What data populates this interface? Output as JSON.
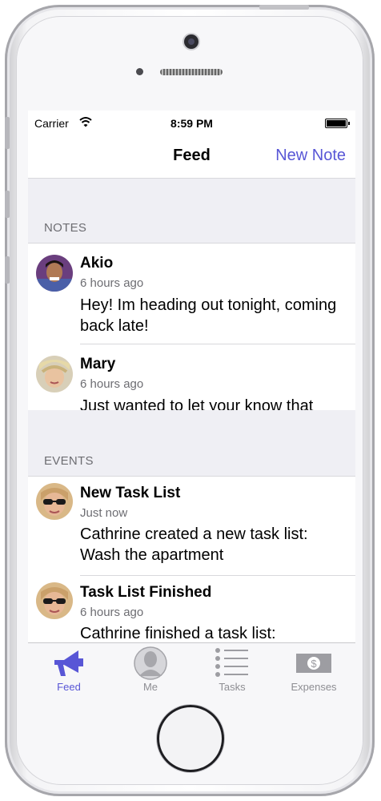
{
  "status_bar": {
    "carrier": "Carrier",
    "time": "8:59 PM"
  },
  "nav": {
    "title": "Feed",
    "action": "New Note"
  },
  "notes_section": {
    "title": "NOTES",
    "items": [
      {
        "name": "Akio",
        "time": "6 hours ago",
        "body": "Hey! Im heading out tonight, coming back late!",
        "avatar": "avatar-akio"
      },
      {
        "name": "Mary",
        "time": "6 hours ago",
        "body": "Just wanted to let your know that",
        "avatar": "avatar-mary"
      }
    ]
  },
  "events_section": {
    "title": "EVENTS",
    "items": [
      {
        "name": "New Task List",
        "time": "Just now",
        "body": "Cathrine created a new task list: Wash the apartment",
        "avatar": "avatar-cathrine"
      },
      {
        "name": "Task List Finished",
        "time": "6 hours ago",
        "body": "Cathrine finished a task list:",
        "avatar": "avatar-cathrine"
      }
    ]
  },
  "tabs": [
    {
      "label": "Feed",
      "icon": "megaphone-icon",
      "active": true
    },
    {
      "label": "Me",
      "icon": "person-icon",
      "active": false
    },
    {
      "label": "Tasks",
      "icon": "list-icon",
      "active": false
    },
    {
      "label": "Expenses",
      "icon": "money-icon",
      "active": false
    }
  ],
  "colors": {
    "accent": "#5856d6",
    "section_bg": "#efeff4",
    "secondary_text": "#6d6d72"
  }
}
